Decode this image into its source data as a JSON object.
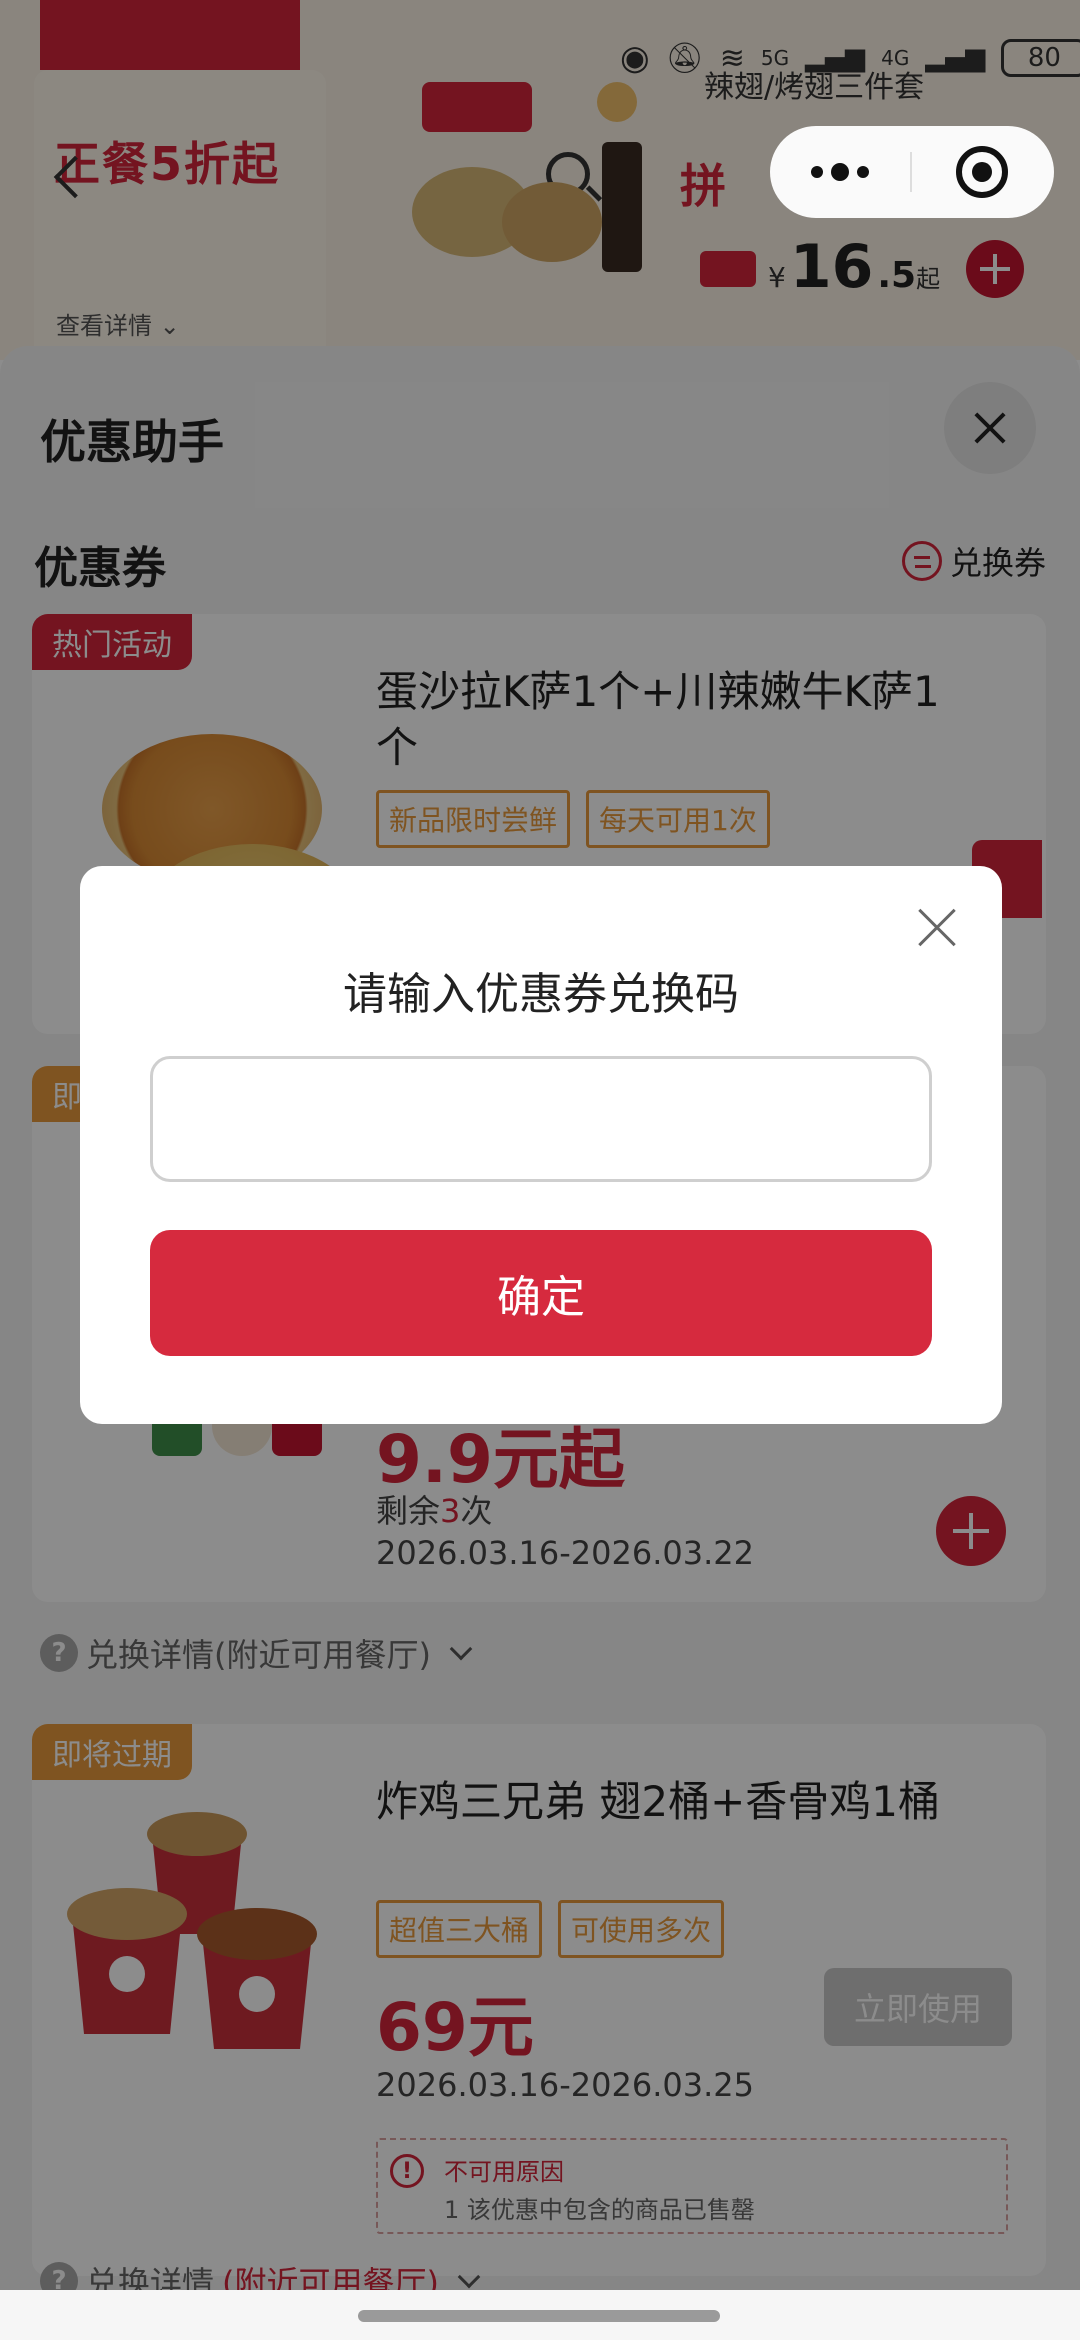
{
  "background": {
    "promo_title": "正餐5折起",
    "detail_link": "查看详情",
    "product_name": "辣翅/烤翅三件套",
    "pin_label": "拼",
    "currency": "¥",
    "price_int": "16",
    "price_dec": ".5",
    "price_suffix": "起",
    "status": {
      "network_5g": "5G",
      "network_4g": "4G",
      "battery": "80"
    }
  },
  "sheet": {
    "title": "优惠助手",
    "section_title": "优惠券",
    "exchange_link": "兑换券",
    "coupons": [
      {
        "tag": "热门活动",
        "name": "蛋沙拉K萨1个+川辣嫩牛K萨1个",
        "badges": [
          "新品限时尝鲜",
          "每天可用1次"
        ]
      },
      {
        "tag": "即",
        "price": "9.9元起",
        "remaining_prefix": "剩余",
        "remaining_num": "3",
        "remaining_suffix": "次",
        "date": "2026.03.16-2026.03.22",
        "detail_text": "兑换详情(附近可用餐厅)"
      },
      {
        "tag": "即将过期",
        "name": "炸鸡三兄弟 翅2桶+香骨鸡1桶",
        "badges": [
          "超值三大桶",
          "可使用多次"
        ],
        "price": "69元",
        "date": "2026.03.16-2026.03.25",
        "use_button": "立即使用",
        "reason_title": "不可用原因",
        "reason_text": "1 该优惠中包含的商品已售罄",
        "detail_prefix": "兑换详情",
        "detail_highlight": "(附近可用餐厅)"
      }
    ]
  },
  "dialog": {
    "title": "请输入优惠券兑换码",
    "input_value": "",
    "confirm": "确定"
  },
  "colors": {
    "brand_red": "#d62a3e",
    "tag_orange": "#e89a3c"
  }
}
